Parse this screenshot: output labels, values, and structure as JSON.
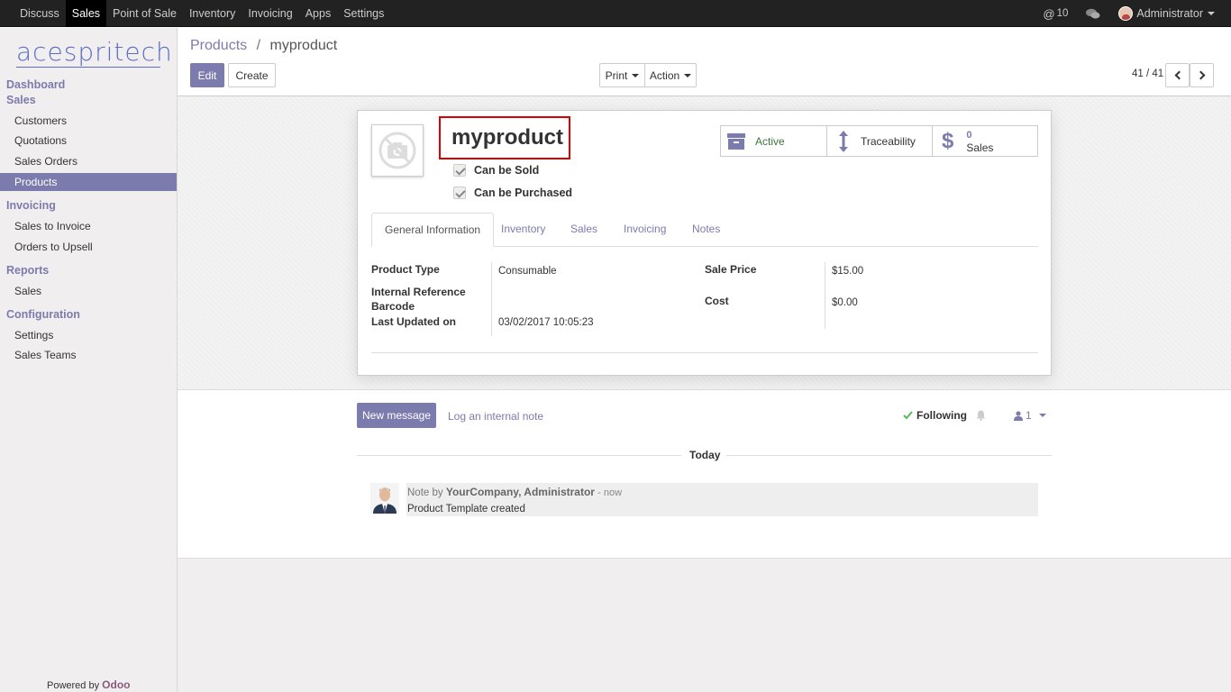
{
  "topbar": {
    "apps": [
      "Discuss",
      "Sales",
      "Point of Sale",
      "Inventory",
      "Invoicing",
      "Apps",
      "Settings"
    ],
    "active_app": "Sales",
    "mentions_count": "10",
    "user_name": "Administrator"
  },
  "sidebar": {
    "logo_text": "acespritech",
    "sections": {
      "dashboard": "Dashboard",
      "sales": "Sales",
      "invoicing": "Invoicing",
      "reports": "Reports",
      "configuration": "Configuration"
    },
    "items": {
      "customers": "Customers",
      "quotations": "Quotations",
      "sales_orders": "Sales Orders",
      "products": "Products",
      "sales_to_invoice": "Sales to Invoice",
      "orders_to_upsell": "Orders to Upsell",
      "reports_sales": "Sales",
      "settings": "Settings",
      "sales_teams": "Sales Teams"
    },
    "powered_by": "Powered by",
    "powered_brand": "Odoo"
  },
  "breadcrumb": {
    "parent": "Products",
    "separator": "/",
    "current": "myproduct"
  },
  "toolbar": {
    "edit": "Edit",
    "create": "Create",
    "print": "Print",
    "action": "Action",
    "pager": "41 / 41"
  },
  "product": {
    "name": "myproduct",
    "can_be_sold": "Can be Sold",
    "can_be_purchased": "Can be Purchased"
  },
  "smart_buttons": {
    "active": "Active",
    "traceability": "Traceability",
    "sales_count": "0",
    "sales_label": "Sales"
  },
  "tabs": [
    "General Information",
    "Inventory",
    "Sales",
    "Invoicing",
    "Notes"
  ],
  "fields": {
    "product_type_label": "Product Type",
    "product_type_value": "Consumable",
    "internal_ref_label": "Internal Reference",
    "barcode_label": "Barcode",
    "last_updated_label": "Last Updated on",
    "last_updated_value": "03/02/2017 10:05:23",
    "sale_price_label": "Sale Price",
    "sale_price_value": "$15.00",
    "cost_label": "Cost",
    "cost_value": "$0.00"
  },
  "chatter": {
    "new_message": "New message",
    "log_note": "Log an internal note",
    "following": "Following",
    "followers_count": "1",
    "today": "Today",
    "message_prefix": "Note by",
    "message_author": "YourCompany, Administrator",
    "message_time": "- now",
    "message_body": "Product Template created"
  },
  "colors": {
    "accent": "#7c7bad",
    "active_green": "#3c763d",
    "highlight_red": "#dd0000"
  }
}
